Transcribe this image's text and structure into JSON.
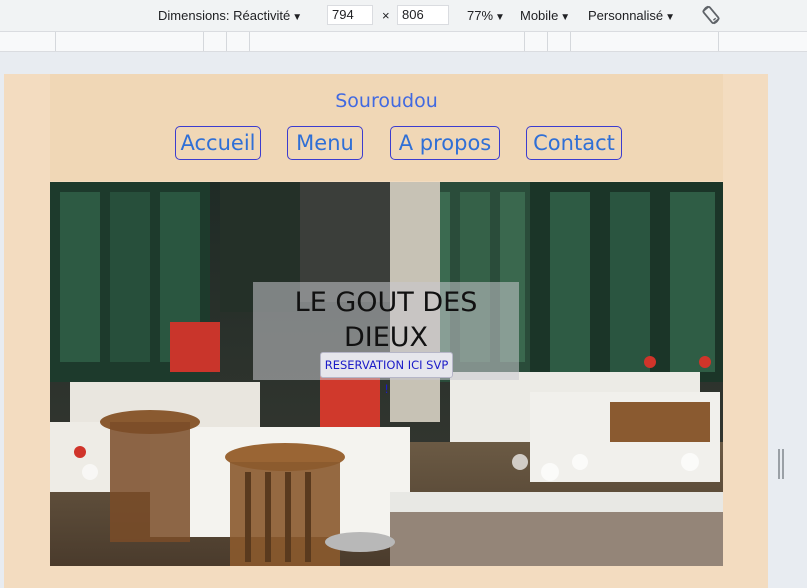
{
  "devtools": {
    "dimensions_label": "Dimensions: Réactivité",
    "width": "794",
    "times": "×",
    "height": "806",
    "zoom": "77%",
    "throttle": "Mobile",
    "custom": "Personnalisé",
    "rotate_icon": "rotate-device-icon"
  },
  "site": {
    "brand": "Souroudou",
    "nav": [
      "Accueil",
      "Menu",
      "A propos",
      "Contact"
    ],
    "hero": {
      "title_line1": "LE GOUT DES",
      "title_line2": "DIEUX",
      "reserve": "RESERVATION ICI SVP !",
      "image_subject": "restaurant-interior-photo"
    },
    "colors": {
      "page_bg": "#f3dcc0",
      "header_bg": "#f0d7b6",
      "link": "#2f6fd6",
      "button_border": "#3c3ccf"
    }
  }
}
